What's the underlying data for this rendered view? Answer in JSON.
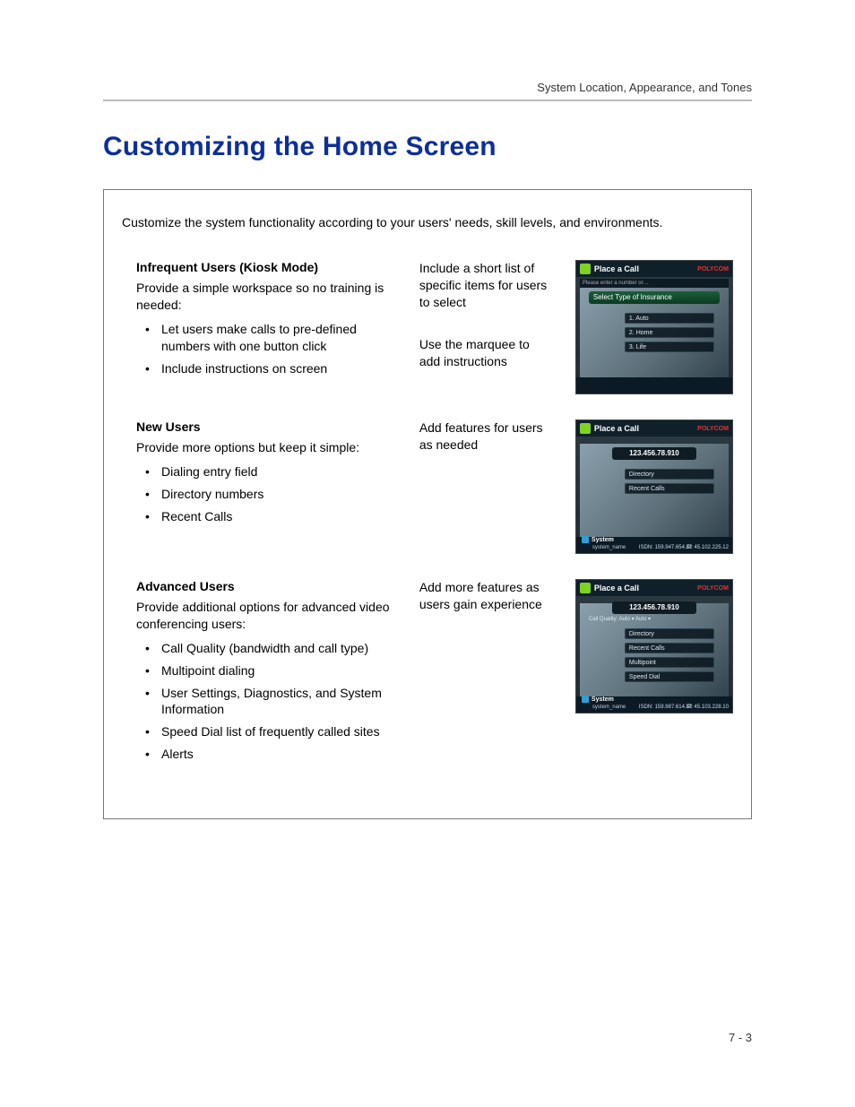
{
  "header": {
    "running": "System Location, Appearance, and Tones"
  },
  "title": "Customizing the Home Screen",
  "intro": "Customize the system functionality according to your users' needs, skill levels, and environments.",
  "sections": [
    {
      "title": "Infrequent Users (Kiosk Mode)",
      "desc": "Provide a simple workspace so no training is needed:",
      "bullets": [
        "Let users make calls to pre-defined numbers with one button click",
        "Include instructions on screen"
      ],
      "notes": [
        "Include a short list of specific items for users to select",
        "Use the marquee to add instructions"
      ]
    },
    {
      "title": "New Users",
      "desc": "Provide more options but keep it simple:",
      "bullets": [
        "Dialing entry field",
        "Directory numbers",
        "Recent Calls"
      ],
      "notes": [
        "Add features for users as needed"
      ]
    },
    {
      "title": "Advanced Users",
      "desc": "Provide additional options for advanced video conferencing users:",
      "bullets": [
        "Call Quality (bandwidth and call type)",
        "Multipoint dialing",
        "User Settings, Diagnostics, and System Information",
        "Speed Dial list of frequently called sites",
        "Alerts"
      ],
      "notes": [
        "Add more features as users gain experience"
      ]
    }
  ],
  "shots": {
    "common": {
      "title": "Place a Call",
      "logo": "POLYCOM",
      "system": "System",
      "system_sub": "system_name"
    },
    "a": {
      "marquee": "Please enter a number or…",
      "band": "Select Type of Insurance",
      "items": [
        "1. Auto",
        "2. Home",
        "3. Life"
      ]
    },
    "b": {
      "ip": "123.456.78.910",
      "items": [
        "Directory",
        "Recent Calls"
      ],
      "isdn": "ISDN: 159.947.654.32",
      "ipaddr": "IP: 45.102.225.12"
    },
    "c": {
      "ip": "123.456.78.910",
      "quality": "Call Quality:  Auto ▾   Auto ▾",
      "items": [
        "Directory",
        "Recent Calls",
        "Multipoint",
        "Speed Dial"
      ],
      "isdn": "ISDN: 159.987.614.32",
      "ipaddr": "IP: 45.103.228.10"
    }
  },
  "page_number": "7 - 3"
}
